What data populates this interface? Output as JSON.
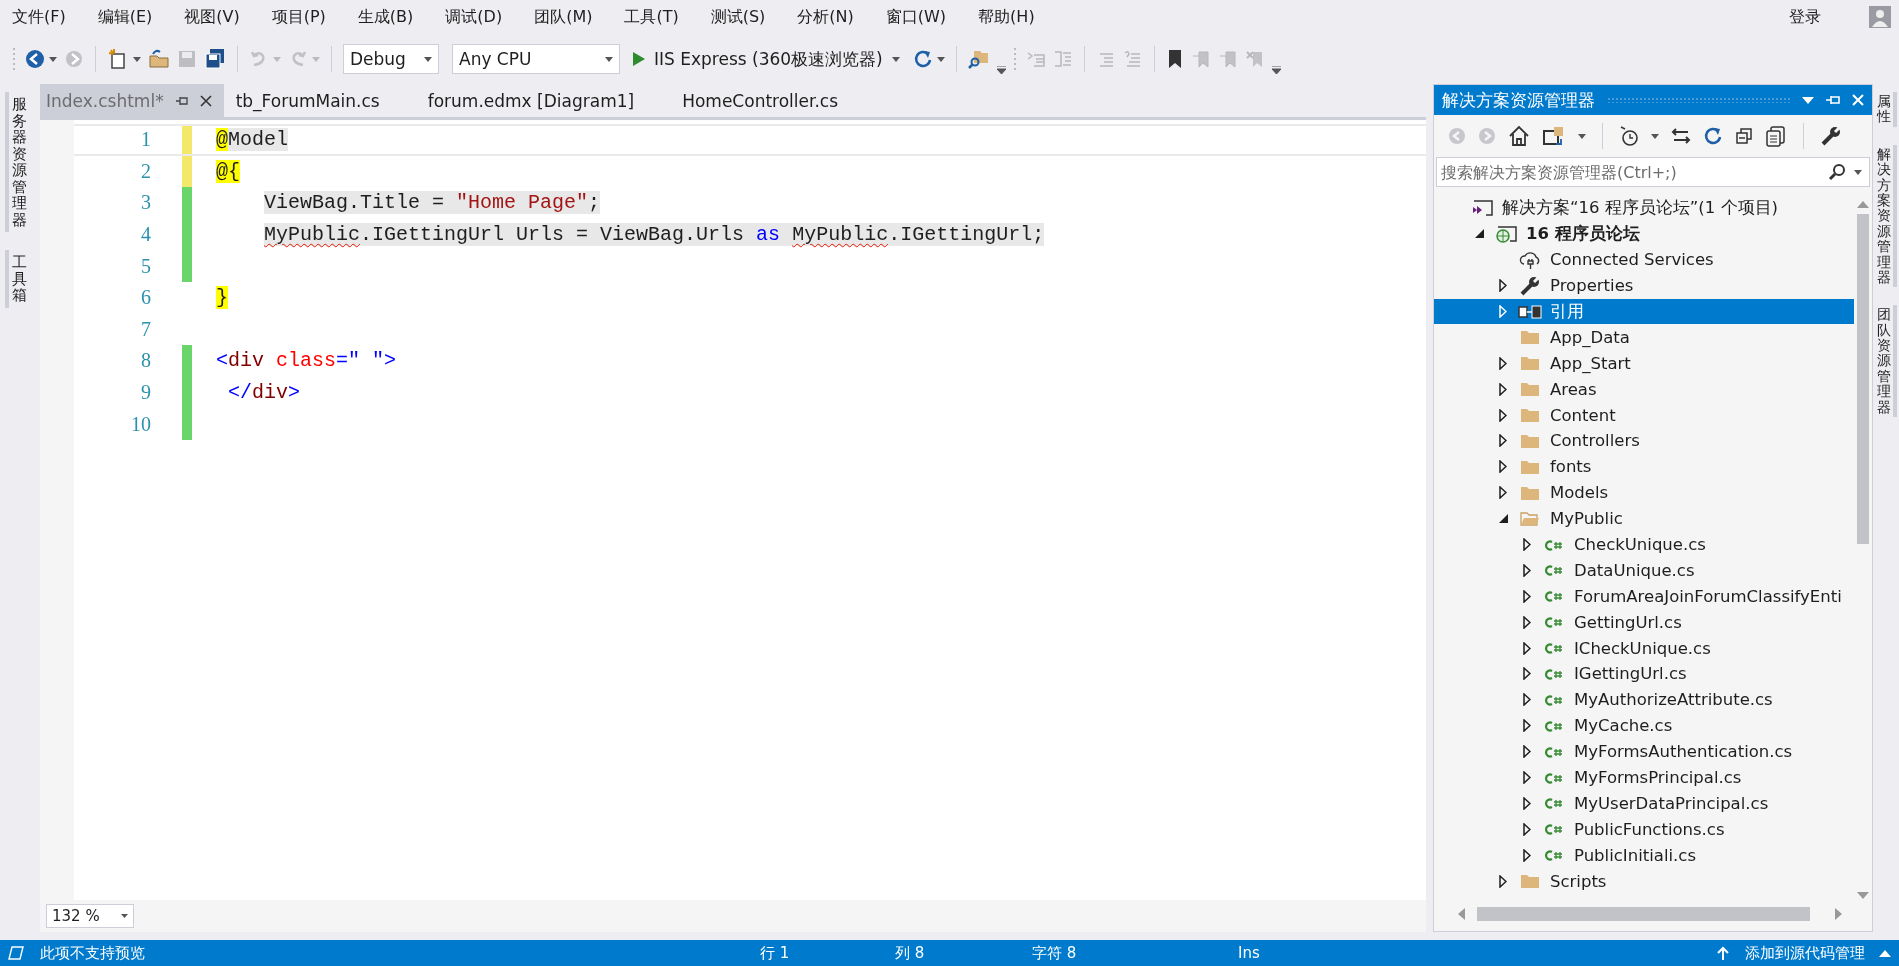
{
  "menu": [
    "文件(F)",
    "编辑(E)",
    "视图(V)",
    "项目(P)",
    "生成(B)",
    "调试(D)",
    "团队(M)",
    "工具(T)",
    "测试(S)",
    "分析(N)",
    "窗口(W)",
    "帮助(H)"
  ],
  "account": {
    "label": "登录"
  },
  "toolbar": {
    "configuration": "Debug",
    "platform": "Any CPU",
    "run_label": "IIS Express (360极速浏览器)"
  },
  "left_dock": [
    "服务器资源管理器",
    "工具箱"
  ],
  "right_dock": [
    "属性",
    "解决方案资源管理器",
    "团队资源管理器"
  ],
  "tabs": [
    {
      "label": "Index.cshtml*",
      "selected": true
    },
    {
      "label": "tb_ForumMain.cs",
      "selected": false
    },
    {
      "label": "forum.edmx [Diagram1]",
      "selected": false
    },
    {
      "label": "HomeController.cs",
      "selected": false
    }
  ],
  "editor": {
    "zoom": "132 %",
    "lines": [
      {
        "number": "1",
        "modified": true,
        "saved": false,
        "current": true,
        "tokens": [
          {
            "kind": "razor",
            "text": "@"
          },
          {
            "kind": "code",
            "text": "Model"
          }
        ]
      },
      {
        "number": "2",
        "modified": true,
        "saved": false,
        "current": false,
        "tokens": [
          {
            "kind": "razor",
            "text": "@{"
          }
        ]
      },
      {
        "number": "3",
        "modified": true,
        "saved": true,
        "current": false,
        "tokens": [
          {
            "kind": "code",
            "text": "    ViewBag.Title = "
          },
          {
            "kind": "string",
            "text": "\"Home Page\""
          },
          {
            "kind": "code",
            "text": ";"
          }
        ]
      },
      {
        "number": "4",
        "modified": true,
        "saved": true,
        "current": false,
        "tokens": [
          {
            "kind": "error",
            "text": "    MyPublic"
          },
          {
            "kind": "code",
            "text": ".IGettingUrl Urls = ViewBag.Urls "
          },
          {
            "kind": "keyword",
            "text": "as "
          },
          {
            "kind": "error",
            "text": "MyPublic"
          },
          {
            "kind": "code",
            "text": ".IGettingUrl;"
          }
        ]
      },
      {
        "number": "5",
        "modified": true,
        "saved": true,
        "current": false
      },
      {
        "number": "6",
        "modified": false,
        "current": false,
        "tokens": [
          {
            "kind": "razor",
            "text": "}"
          }
        ]
      },
      {
        "number": "7",
        "modified": false,
        "current": false
      },
      {
        "number": "8",
        "modified": true,
        "saved": true,
        "current": false,
        "tokens": [
          {
            "kind": "tag",
            "text": "<"
          },
          {
            "kind": "element",
            "text": "div"
          },
          {
            "kind": "attr",
            "text": " class"
          },
          {
            "kind": "tag",
            "text": "=\" \">"
          }
        ]
      },
      {
        "number": "9",
        "modified": true,
        "saved": true,
        "current": false,
        "tokens": [
          {
            "kind": "tag",
            "text": " </"
          },
          {
            "kind": "element",
            "text": "div"
          },
          {
            "kind": "tag",
            "text": ">"
          }
        ]
      },
      {
        "number": "10",
        "modified": true,
        "saved": true,
        "current": false
      }
    ]
  },
  "solution_explorer": {
    "title": "解决方案资源管理器",
    "search": {
      "placeholder": "搜索解决方案资源管理器(Ctrl+;)"
    },
    "tree": [
      {
        "label": "解决方案“16 程序员论坛”(1 个项目)",
        "kind": "solution",
        "selected": false,
        "children": [
          {
            "label": "16 程序员论坛",
            "kind": "project",
            "expanded": true,
            "selected": false,
            "children": [
              {
                "label": "Connected Services",
                "kind": "service",
                "selected": false
              },
              {
                "label": "Properties",
                "kind": "properties",
                "expanded": false,
                "selected": false
              },
              {
                "label": "引用",
                "kind": "references",
                "expanded": false,
                "selected": true
              },
              {
                "label": "App_Data",
                "kind": "folder",
                "selected": false
              },
              {
                "label": "App_Start",
                "kind": "folder",
                "expanded": false,
                "selected": false
              },
              {
                "label": "Areas",
                "kind": "folder",
                "expanded": false,
                "selected": false
              },
              {
                "label": "Content",
                "kind": "folder",
                "expanded": false,
                "selected": false
              },
              {
                "label": "Controllers",
                "kind": "folder",
                "expanded": false,
                "selected": false
              },
              {
                "label": "fonts",
                "kind": "folder",
                "expanded": false,
                "selected": false
              },
              {
                "label": "Models",
                "kind": "folder",
                "expanded": false,
                "selected": false
              },
              {
                "label": "MyPublic",
                "kind": "folder",
                "expanded": true,
                "selected": false,
                "children": [
                  {
                    "label": "CheckUnique.cs",
                    "kind": "csfile",
                    "expanded": false,
                    "selected": false
                  },
                  {
                    "label": "DataUnique.cs",
                    "kind": "csfile",
                    "expanded": false,
                    "selected": false
                  },
                  {
                    "label": "ForumAreaJoinForumClassifyEnti",
                    "kind": "csfile",
                    "expanded": false,
                    "selected": false
                  },
                  {
                    "label": "GettingUrl.cs",
                    "kind": "csfile",
                    "expanded": false,
                    "selected": false
                  },
                  {
                    "label": "ICheckUnique.cs",
                    "kind": "csfile",
                    "expanded": false,
                    "selected": false
                  },
                  {
                    "label": "IGettingUrl.cs",
                    "kind": "csfile",
                    "expanded": false,
                    "selected": false
                  },
                  {
                    "label": "MyAuthorizeAttribute.cs",
                    "kind": "csfile",
                    "expanded": false,
                    "selected": false
                  },
                  {
                    "label": "MyCache.cs",
                    "kind": "csfile",
                    "expanded": false,
                    "selected": false
                  },
                  {
                    "label": "MyFormsAuthentication.cs",
                    "kind": "csfile",
                    "expanded": false,
                    "selected": false
                  },
                  {
                    "label": "MyFormsPrincipal.cs",
                    "kind": "csfile",
                    "expanded": false,
                    "selected": false
                  },
                  {
                    "label": "MyUserDataPrincipal.cs",
                    "kind": "csfile",
                    "expanded": false,
                    "selected": false
                  },
                  {
                    "label": "PublicFunctions.cs",
                    "kind": "csfile",
                    "expanded": false,
                    "selected": false
                  },
                  {
                    "label": "PublicInitiali.cs",
                    "kind": "csfile",
                    "expanded": false,
                    "selected": false
                  }
                ]
              },
              {
                "label": "Scripts",
                "kind": "folder",
                "expanded": false,
                "selected": false
              }
            ]
          }
        ]
      }
    ]
  },
  "status_bar": {
    "message": "此项不支持预览",
    "line": "行 1",
    "column": "列 8",
    "char": "字符 8",
    "mode": "Ins",
    "source_control": "添加到源代码管理"
  }
}
